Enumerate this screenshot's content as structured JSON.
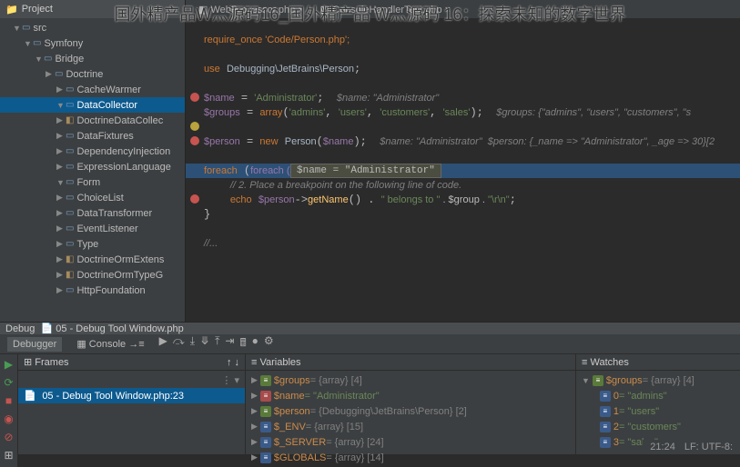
{
  "banner": "国外精产品W灬源码16_国外精产品 W灬源码 16：探索未知的数字世界",
  "project": {
    "title": "Project"
  },
  "tree": [
    {
      "l": "src",
      "i": 1,
      "o": 1,
      "t": "fold"
    },
    {
      "l": "Symfony",
      "i": 2,
      "o": 1,
      "t": "fold"
    },
    {
      "l": "Bridge",
      "i": 3,
      "o": 1,
      "t": "fold"
    },
    {
      "l": "Doctrine",
      "i": 4,
      "o": 0,
      "t": "fold"
    },
    {
      "l": "CacheWarmer",
      "i": 5,
      "o": 0,
      "t": "fold"
    },
    {
      "l": "DataCollector",
      "i": 5,
      "o": 1,
      "t": "fold",
      "sel": 1
    },
    {
      "l": "DoctrineDataCollec",
      "i": 5,
      "o": 0,
      "t": "file"
    },
    {
      "l": "DataFixtures",
      "i": 5,
      "o": 0,
      "t": "fold"
    },
    {
      "l": "DependencyInjection",
      "i": 5,
      "o": 0,
      "t": "fold"
    },
    {
      "l": "ExpressionLanguage",
      "i": 5,
      "o": 0,
      "t": "fold"
    },
    {
      "l": "Form",
      "i": 5,
      "o": 1,
      "t": "fold"
    },
    {
      "l": "ChoiceList",
      "i": 5,
      "o": 0,
      "t": "fold"
    },
    {
      "l": "DataTransformer",
      "i": 5,
      "o": 0,
      "t": "fold"
    },
    {
      "l": "EventListener",
      "i": 5,
      "o": 0,
      "t": "fold"
    },
    {
      "l": "Type",
      "i": 5,
      "o": 0,
      "t": "fold"
    },
    {
      "l": "DoctrineOrmExtens",
      "i": 5,
      "o": 0,
      "t": "file"
    },
    {
      "l": "DoctrineOrmTypeG",
      "i": 5,
      "o": 0,
      "t": "file"
    },
    {
      "l": "HttpFoundation",
      "i": 5,
      "o": 0,
      "t": "fold"
    }
  ],
  "tabs": [
    {
      "l": "WebProcessor.php"
    },
    {
      "l": "ConsoleHandlerTest.php"
    }
  ],
  "code": {
    "require": "require_once 'Code/Person.php';",
    "use": "use Debugging\\JetBrains\\Person;",
    "name_assign": "$name = 'Administrator';",
    "name_hint": "$name: \"Administrator\"",
    "groups_assign": "$groups = array('admins', 'users', 'customers', 'sales');",
    "groups_hint": "$groups: {\"admins\", \"users\", \"customers\", \"s",
    "person_assign": "$person = new Person($name);",
    "person_hint": "$name: \"Administrator\"  $person: {_name => \"Administrator\", _age => 30}[2",
    "foreach": "foreach ($gr",
    "tooltip": "$name = \"Administrator\"",
    "comment": "// 2. Place a breakpoint on the following line of code.",
    "echo1": "echo $person->getName() . ",
    "echo2": "\" belongs to \"",
    "echo3": " . $group . ",
    "echo4": "\"\\r\\n\"",
    "slash": "//..."
  },
  "debug": {
    "title": "05 - Debug Tool Window.php",
    "tabDebugger": "Debugger",
    "tabConsole": "Console",
    "framesTitle": "Frames",
    "varsTitle": "Variables",
    "watchTitle": "Watches",
    "frame": "05 - Debug Tool Window.php:23"
  },
  "vars": [
    {
      "ic": "g",
      "n": "$groups",
      "v": " = {array} [4]",
      "cls": "gray"
    },
    {
      "ic": "r",
      "n": "$name",
      "v": " = \"Administrator\"",
      "cls": "grn"
    },
    {
      "ic": "g",
      "n": "$person",
      "v": " = {Debugging\\JetBrains\\Person} [2]",
      "cls": "gray"
    },
    {
      "ic": "b",
      "n": "$_ENV",
      "v": " = {array} [15]",
      "cls": "gray"
    },
    {
      "ic": "b",
      "n": "$_SERVER",
      "v": " = {array} [24]",
      "cls": "gray"
    },
    {
      "ic": "b",
      "n": "$GLOBALS",
      "v": " = {array} [14]",
      "cls": "gray"
    }
  ],
  "watches": {
    "root": {
      "n": "$groups",
      "v": " = {array} [4]"
    },
    "items": [
      {
        "k": "0",
        "v": " = \"admins\""
      },
      {
        "k": "1",
        "v": " = \"users\""
      },
      {
        "k": "2",
        "v": " = \"customers\""
      },
      {
        "k": "3",
        "v": " = \"sales\""
      }
    ]
  },
  "status": {
    "pos": "21:24",
    "enc": "LF: UTF-8:"
  }
}
